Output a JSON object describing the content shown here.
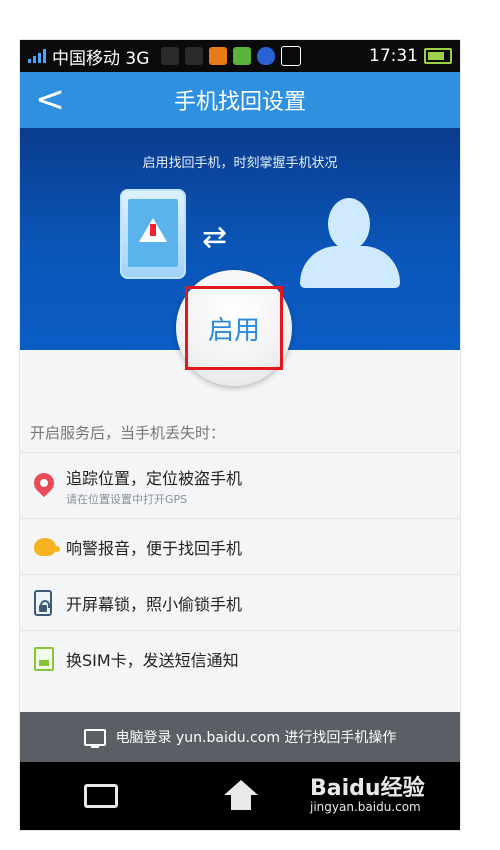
{
  "status_bar": {
    "carrier": "中国移动 3G",
    "time": "17:31"
  },
  "header": {
    "back_label": "<",
    "title": "手机找回设置"
  },
  "hero": {
    "tagline": "启用找回手机，时刻掌握手机状况",
    "enable_button": "启用"
  },
  "features": {
    "heading": "开启服务后，当手机丢失时：",
    "items": [
      {
        "icon": "location-pin-icon",
        "text": "追踪位置，定位被盗手机",
        "sub": "请在位置设置中打开GPS"
      },
      {
        "icon": "alarm-icon",
        "text": "响警报音，便于找回手机",
        "sub": ""
      },
      {
        "icon": "lock-screen-icon",
        "text": "开屏幕锁，照小偷锁手机",
        "sub": ""
      },
      {
        "icon": "sim-card-icon",
        "text": "换SIM卡，发送短信通知",
        "sub": ""
      }
    ]
  },
  "bottom_bar": {
    "text": "电脑登录 yun.baidu.com 进行找回手机操作"
  },
  "watermark": {
    "brand": "Baidu经验",
    "url": "jingyan.baidu.com"
  },
  "colors": {
    "title_bar": "#2f90e0",
    "hero_top": "#0a3c8e",
    "enable_text": "#2b8ad9",
    "highlight_box": "#e1191f",
    "bottom_bar": "#5a5f66"
  }
}
